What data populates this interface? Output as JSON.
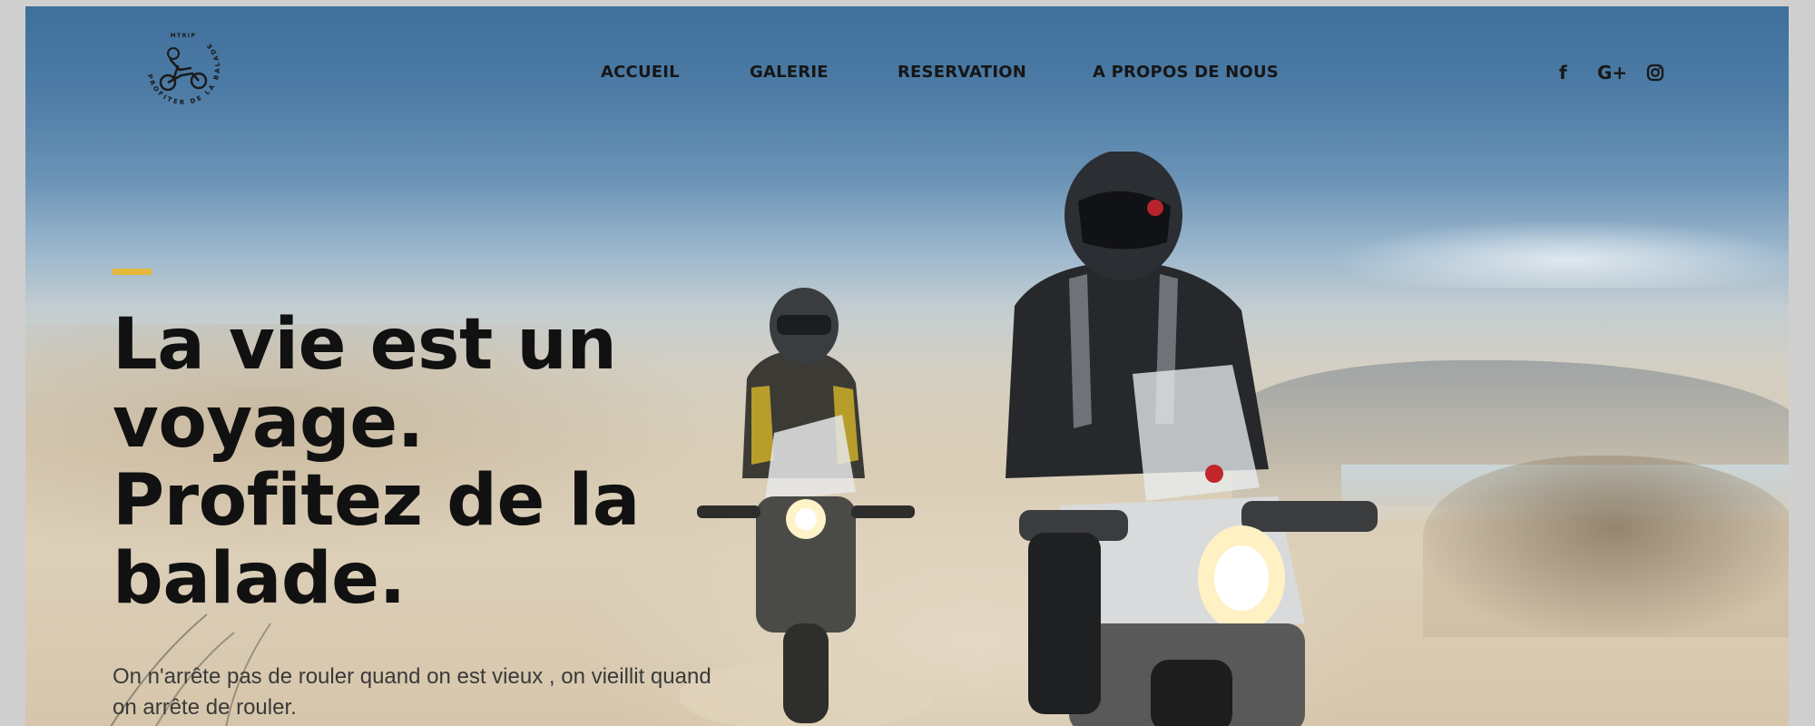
{
  "brand": {
    "logo_top_text": "MTRIP",
    "logo_ring_text": "PROFITER DE LA BALADE",
    "logo_icon": "motorcycle-rider-icon"
  },
  "nav": {
    "items": [
      {
        "label": "ACCUEIL"
      },
      {
        "label": "GALERIE"
      },
      {
        "label": "RESERVATION"
      },
      {
        "label": "A PROPOS DE NOUS"
      }
    ]
  },
  "social": {
    "items": [
      {
        "icon": "facebook-icon",
        "glyph": "f"
      },
      {
        "icon": "google-plus-icon",
        "glyph": "G+"
      },
      {
        "icon": "instagram-icon",
        "glyph": ""
      }
    ]
  },
  "hero": {
    "headline_lines": [
      "La vie est un",
      "voyage.",
      "Profitez de la",
      "balade."
    ],
    "subtitle": "On n'arrête pas de rouler quand on est vieux , on vieillit quand on arrête de rouler.",
    "accent_color": "#e5b83a"
  },
  "colors": {
    "text_dark": "#111111",
    "sky_top": "#3f6f9b",
    "sand": "#dccfb8"
  }
}
